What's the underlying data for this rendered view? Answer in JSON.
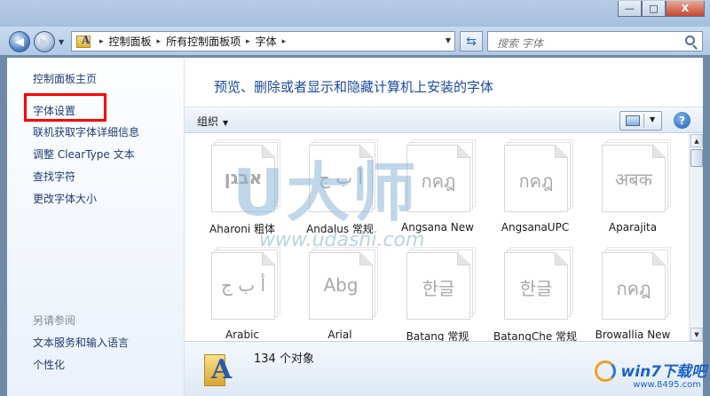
{
  "window": {
    "minimize": "—",
    "maximize": "□",
    "close": "X"
  },
  "address": {
    "crumbs": [
      "控制面板",
      "所有控制面板项",
      "字体"
    ]
  },
  "search": {
    "placeholder": "搜索 字体"
  },
  "left_pane": {
    "links": [
      {
        "label": "控制面板主页",
        "name": "control-panel-home-link"
      },
      {
        "label": "字体设置",
        "name": "font-settings-link"
      },
      {
        "label": "联机获取字体详细信息",
        "name": "online-font-info-link"
      },
      {
        "label": "调整 ClearType 文本",
        "name": "cleartype-link"
      },
      {
        "label": "查找字符",
        "name": "find-character-link"
      },
      {
        "label": "更改字体大小",
        "name": "change-font-size-link"
      }
    ],
    "see_also": "另请参阅",
    "see_also_links": [
      {
        "label": "文本服务和输入语言",
        "name": "text-services-link"
      },
      {
        "label": "个性化",
        "name": "personalization-link"
      }
    ]
  },
  "main": {
    "heading": "预览、删除或者显示和隐藏计算机上安装的字体",
    "toolbar": {
      "organize": "组织",
      "help": "?"
    },
    "fonts": [
      {
        "name": "Aharoni 粗体",
        "sample": "אבגן",
        "bold": true
      },
      {
        "name": "Andalus 常规",
        "sample": "أ ب ج",
        "bold": false
      },
      {
        "name": "Angsana New",
        "sample": "กคฎ",
        "bold": false
      },
      {
        "name": "AngsanaUPC",
        "sample": "กคฎ",
        "bold": false
      },
      {
        "name": "Aparajita",
        "sample": "अबक",
        "bold": false
      },
      {
        "name": "Arabic",
        "sample": "أ ب ج",
        "bold": false
      },
      {
        "name": "Arial",
        "sample": "Abg",
        "bold": false
      },
      {
        "name": "Batang 常规",
        "sample": "한글",
        "bold": false
      },
      {
        "name": "BatangChe 常规",
        "sample": "한글",
        "bold": false
      },
      {
        "name": "Browallia New",
        "sample": "กคฎ",
        "bold": false
      }
    ],
    "details": {
      "count": "134 个对象"
    }
  },
  "watermark": {
    "text": "U大师",
    "url": "www.udashi.com"
  },
  "corner_logo": {
    "name": "win7下载吧",
    "url": "www.8495.com"
  },
  "colors": {
    "heading": "#1c4aa0",
    "link": "#1f3c75",
    "highlight": "#ff0000"
  }
}
